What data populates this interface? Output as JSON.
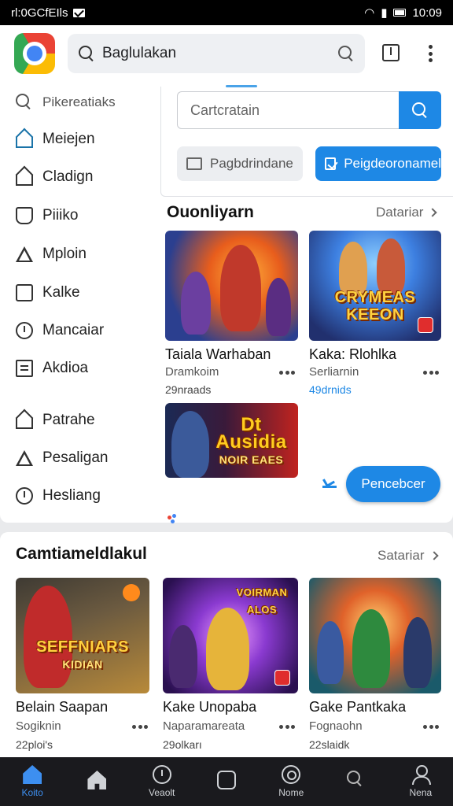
{
  "status_bar": {
    "left_text": "rl:0GCfEIls",
    "time": "10:09"
  },
  "header": {
    "search_query": "Baglulakan"
  },
  "sidebar": {
    "items": [
      {
        "label": "Pikereatiaks",
        "icon": "search-icon"
      },
      {
        "label": "Meiejen",
        "icon": "home-icon"
      },
      {
        "label": "Cladign",
        "icon": "house-icon"
      },
      {
        "label": "Piiiko",
        "icon": "bag-icon"
      },
      {
        "label": "Mploin",
        "icon": "triangle-icon"
      },
      {
        "label": "Kalke",
        "icon": "box-icon"
      },
      {
        "label": "Mancaiar",
        "icon": "clock-icon"
      },
      {
        "label": "Akdioa",
        "icon": "list-icon"
      },
      {
        "label": "Patrahe",
        "icon": "house-icon"
      },
      {
        "label": "Pesaligan",
        "icon": "triangle-icon"
      },
      {
        "label": "Hesliang",
        "icon": "clock-icon"
      }
    ]
  },
  "search_panel": {
    "placeholder": "Cartcratain",
    "secondary_button": "Pagbdrindane",
    "primary_button": "Peigdeoronamel"
  },
  "section1": {
    "title": "Ouonliyarn",
    "see_all": "Datariar",
    "games": [
      {
        "title": "Taiala Warhaban",
        "developer": "Dramkoim",
        "count": "29nraads",
        "thumb_text": "",
        "accent": "#c0392b"
      },
      {
        "title": "Kaka: Rlohlka",
        "developer": "Serliarnin",
        "count": "49drnids",
        "thumb_text": "CRYMEAS KEEON",
        "accent": "#2e6fd8"
      },
      {
        "title": "",
        "developer": "",
        "count": "",
        "thumb_text": "Dt Ausidia",
        "thumb_sub": "NOIR EAES",
        "accent": "#1a1a3a"
      }
    ],
    "install_button": "Pencebcer"
  },
  "section2": {
    "title": "Camtiameldlakul",
    "see_all": "Satariar",
    "games": [
      {
        "title": "Belain Saapan",
        "developer": "Sogiknin",
        "count": "22ploi's",
        "thumb_text": "SEFFNIARS",
        "thumb_sub": "KIDIAN"
      },
      {
        "title": "Kake Unopaba",
        "developer": "Naparamareata",
        "count": "29olkarı",
        "thumb_text": "VOIRMAN ALOS"
      },
      {
        "title": "Gake Pantkaka",
        "developer": "Fognaohn",
        "count": "22slaidk",
        "thumb_text": ""
      }
    ]
  },
  "nav": {
    "items": [
      {
        "label": "Koito",
        "icon": "home-icon"
      },
      {
        "label": "",
        "icon": "house-icon"
      },
      {
        "label": "Veaolt",
        "icon": "clock-icon"
      },
      {
        "label": "",
        "icon": "square-icon"
      },
      {
        "label": "Nome",
        "icon": "ring-icon"
      },
      {
        "label": "",
        "icon": "search-icon"
      },
      {
        "label": "Nena",
        "icon": "person-icon"
      }
    ]
  },
  "colors": {
    "accent": "#1e88e5",
    "nav_bg": "#1a1a1e",
    "nav_active": "#3d8ff0"
  }
}
